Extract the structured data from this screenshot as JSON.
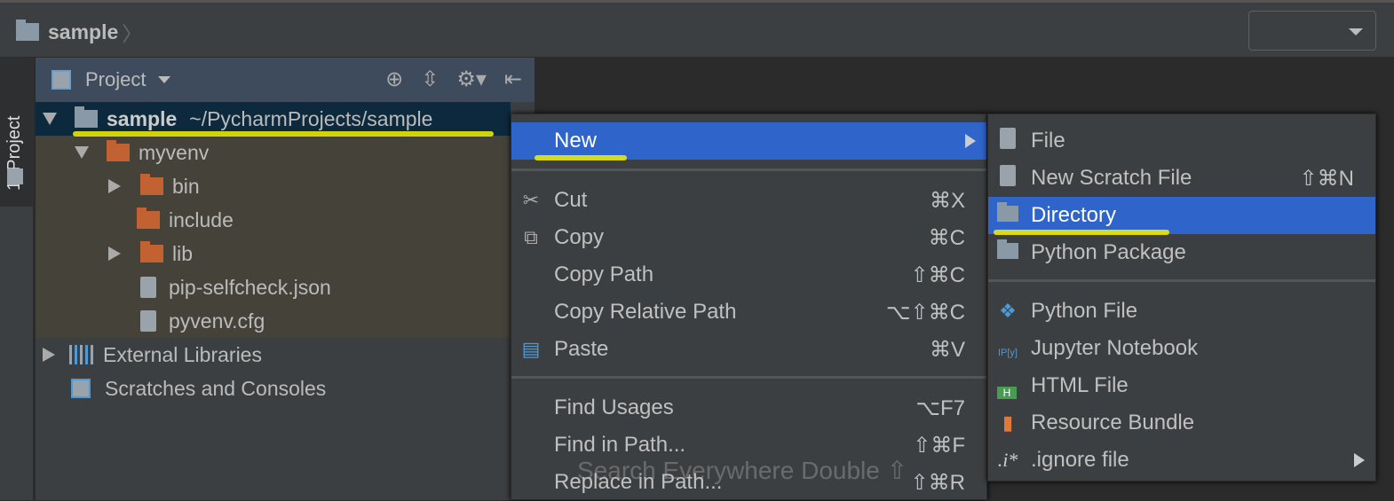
{
  "navbar": {
    "breadcrumb": "sample",
    "breadcrumb_sep": "〉"
  },
  "tool_stripe": {
    "project_tab": "1: Project"
  },
  "project_panel": {
    "title": "Project",
    "tree": [
      {
        "label": "sample",
        "path": "~/PycharmProjects/sample",
        "icon": "folder-icon",
        "expanded": true,
        "selected": true
      },
      {
        "label": "myvenv",
        "icon": "folder-excluded-icon",
        "expanded": true
      },
      {
        "label": "bin",
        "icon": "folder-excluded-icon",
        "expanded": false
      },
      {
        "label": "include",
        "icon": "folder-excluded-icon"
      },
      {
        "label": "lib",
        "icon": "folder-excluded-icon",
        "expanded": false
      },
      {
        "label": "pip-selfcheck.json",
        "icon": "json-file-icon"
      },
      {
        "label": "pyvenv.cfg",
        "icon": "text-file-icon"
      },
      {
        "label": "External Libraries",
        "icon": "libraries-icon",
        "expanded": false
      },
      {
        "label": "Scratches and Consoles",
        "icon": "scratches-icon"
      }
    ]
  },
  "editor": {
    "hint": "Search Everywhere  Double ⇧"
  },
  "context_menu": {
    "items": [
      {
        "label": "New",
        "shortcut": "",
        "submenu": true,
        "selected": true
      },
      {
        "label": "Cut",
        "shortcut": "⌘X",
        "icon": "scissors-icon"
      },
      {
        "label": "Copy",
        "shortcut": "⌘C",
        "icon": "copy-icon"
      },
      {
        "label": "Copy Path",
        "shortcut": "⇧⌘C"
      },
      {
        "label": "Copy Relative Path",
        "shortcut": "⌥⇧⌘C"
      },
      {
        "label": "Paste",
        "shortcut": "⌘V",
        "icon": "paste-icon"
      },
      {
        "label": "Find Usages",
        "shortcut": "⌥F7"
      },
      {
        "label": "Find in Path...",
        "shortcut": "⇧⌘F"
      },
      {
        "label": "Replace in Path...",
        "shortcut": "⇧⌘R"
      }
    ]
  },
  "new_submenu": {
    "items": [
      {
        "label": "File",
        "shortcut": "",
        "icon": "file-icon"
      },
      {
        "label": "New Scratch File",
        "shortcut": "⇧⌘N",
        "icon": "scratch-file-icon"
      },
      {
        "label": "Directory",
        "shortcut": "",
        "icon": "folder-icon",
        "selected": true
      },
      {
        "label": "Python Package",
        "shortcut": "",
        "icon": "package-icon"
      },
      {
        "label": "Python File",
        "shortcut": "",
        "icon": "python-icon"
      },
      {
        "label": "Jupyter Notebook",
        "shortcut": "",
        "icon": "jupyter-icon",
        "icon_text": "IP[y]"
      },
      {
        "label": "HTML File",
        "shortcut": "",
        "icon": "html-icon",
        "icon_text": "H"
      },
      {
        "label": "Resource Bundle",
        "shortcut": "",
        "icon": "resource-bundle-icon"
      },
      {
        "label": ".ignore file",
        "shortcut": "",
        "icon": "ignore-file-icon",
        "icon_text": ".i*",
        "submenu": true
      }
    ]
  },
  "colors": {
    "selection": "#2f65ca",
    "annotation": "#f4f000",
    "excluded_folder": "#c26233"
  }
}
